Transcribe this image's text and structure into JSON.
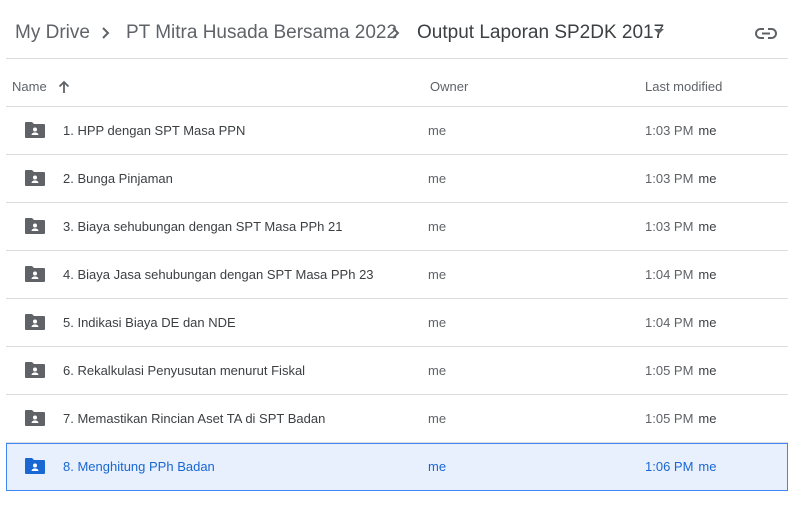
{
  "breadcrumb": {
    "items": [
      "My Drive",
      "PT Mitra Husada Bersama 2022",
      "Output Laporan SP2DK 2017"
    ],
    "separator_icon": "chevron-right-icon",
    "current_dropdown_icon": "caret-down-icon",
    "link_icon": "link-icon"
  },
  "header": {
    "name_label": "Name",
    "owner_label": "Owner",
    "modified_label": "Last modified",
    "sort_icon": "arrow-up-icon"
  },
  "files": [
    {
      "name": "1. HPP dengan SPT Masa PPN",
      "owner": "me",
      "modified": "1:03 PM",
      "modified_by": "me",
      "icon": "shared-folder-icon",
      "selected": false
    },
    {
      "name": "2. Bunga Pinjaman",
      "owner": "me",
      "modified": "1:03 PM",
      "modified_by": "me",
      "icon": "shared-folder-icon",
      "selected": false
    },
    {
      "name": "3. Biaya sehubungan dengan SPT Masa PPh 21",
      "owner": "me",
      "modified": "1:03 PM",
      "modified_by": "me",
      "icon": "shared-folder-icon",
      "selected": false
    },
    {
      "name": "4. Biaya Jasa sehubungan dengan SPT Masa PPh 23",
      "owner": "me",
      "modified": "1:04 PM",
      "modified_by": "me",
      "icon": "shared-folder-icon",
      "selected": false
    },
    {
      "name": "5. Indikasi Biaya DE dan NDE",
      "owner": "me",
      "modified": "1:04 PM",
      "modified_by": "me",
      "icon": "shared-folder-icon",
      "selected": false
    },
    {
      "name": "6. Rekalkulasi Penyusutan menurut Fiskal",
      "owner": "me",
      "modified": "1:05 PM",
      "modified_by": "me",
      "icon": "shared-folder-icon",
      "selected": false
    },
    {
      "name": "7. Memastikan Rincian Aset TA di SPT Badan",
      "owner": "me",
      "modified": "1:05 PM",
      "modified_by": "me",
      "icon": "shared-folder-icon",
      "selected": false
    },
    {
      "name": "8. Menghitung PPh Badan",
      "owner": "me",
      "modified": "1:06 PM",
      "modified_by": "me",
      "icon": "shared-folder-icon",
      "selected": true
    }
  ],
  "colors": {
    "selected_bg": "#e8f0fe",
    "selected_border": "#4285f4",
    "selected_text": "#1967d2",
    "folder_icon": "#5f6368"
  }
}
